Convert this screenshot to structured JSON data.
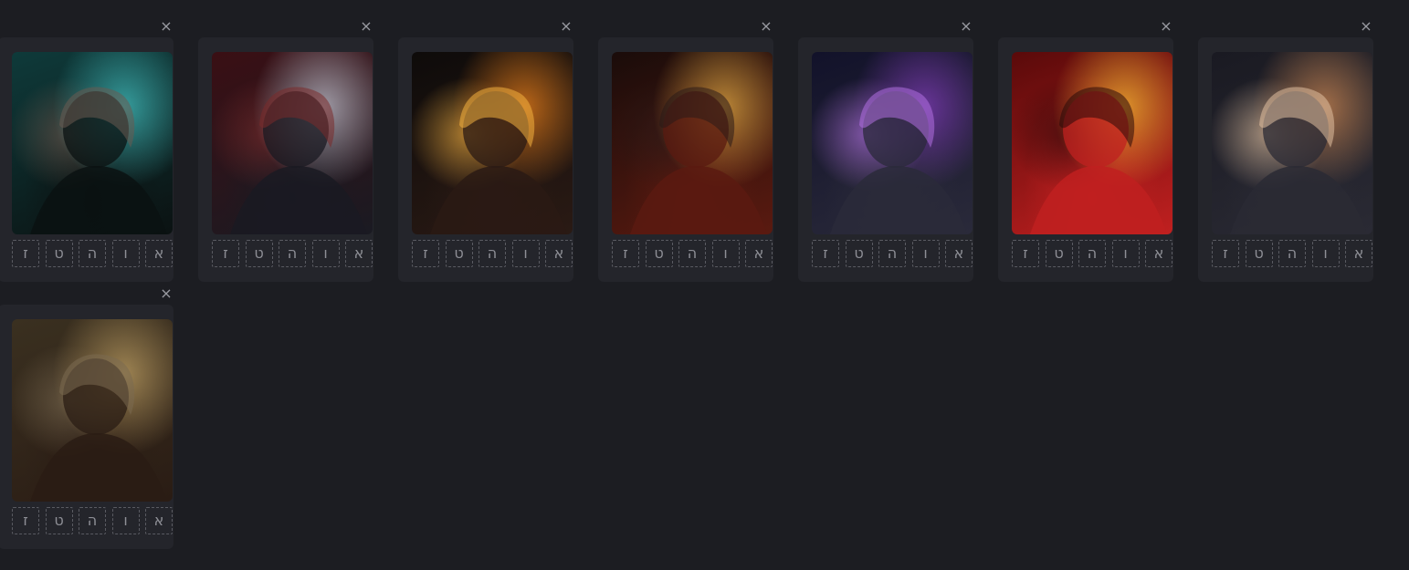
{
  "cards": [
    {
      "close_label": "×",
      "art_name": "dark-haired-figure-rain-teal",
      "tags": [
        "ז",
        "ט",
        "ה",
        "ו",
        "א"
      ],
      "palette": [
        "#0e3a3a",
        "#3fb7b7",
        "#0b1212",
        "#6a5a50"
      ]
    },
    {
      "close_label": "×",
      "art_name": "silver-haired-girl-red",
      "tags": [
        "ז",
        "ט",
        "ה",
        "ו",
        "א"
      ],
      "palette": [
        "#3a0f14",
        "#b8b8c4",
        "#1a1a22",
        "#7a2a2a"
      ]
    },
    {
      "close_label": "×",
      "art_name": "dark-figure-orange-flames",
      "tags": [
        "ז",
        "ט",
        "ה",
        "ו",
        "א"
      ],
      "palette": [
        "#0e0b0a",
        "#e07a1a",
        "#2a1a14",
        "#f2b040"
      ]
    },
    {
      "close_label": "×",
      "art_name": "red-hatted-figure-embers",
      "tags": [
        "ז",
        "ט",
        "ה",
        "ו",
        "א"
      ],
      "palette": [
        "#1a0c0a",
        "#d8a040",
        "#5a1a10",
        "#2a1a18"
      ]
    },
    {
      "close_label": "×",
      "art_name": "hooded-figure-purple",
      "tags": [
        "ז",
        "ט",
        "ה",
        "ו",
        "א"
      ],
      "palette": [
        "#12122a",
        "#7a3ab0",
        "#2a2a3a",
        "#b070e0"
      ]
    },
    {
      "close_label": "×",
      "art_name": "blonde-figure-red-flames",
      "tags": [
        "ז",
        "ט",
        "ה",
        "ו",
        "א"
      ],
      "palette": [
        "#5a0a0a",
        "#f0b030",
        "#c02020",
        "#2a0a0a"
      ]
    },
    {
      "close_label": "×",
      "art_name": "dark-haired-figure-sparks",
      "tags": [
        "ז",
        "ט",
        "ה",
        "ו",
        "א"
      ],
      "palette": [
        "#1a1a22",
        "#c08050",
        "#2a2a34",
        "#e0c0a0"
      ]
    },
    {
      "close_label": "×",
      "art_name": "brown-haired-figure-car",
      "tags": [
        "ז",
        "ט",
        "ה",
        "ו",
        "א"
      ],
      "palette": [
        "#3a3020",
        "#b89a60",
        "#2a1c14",
        "#7a6a50"
      ]
    }
  ]
}
